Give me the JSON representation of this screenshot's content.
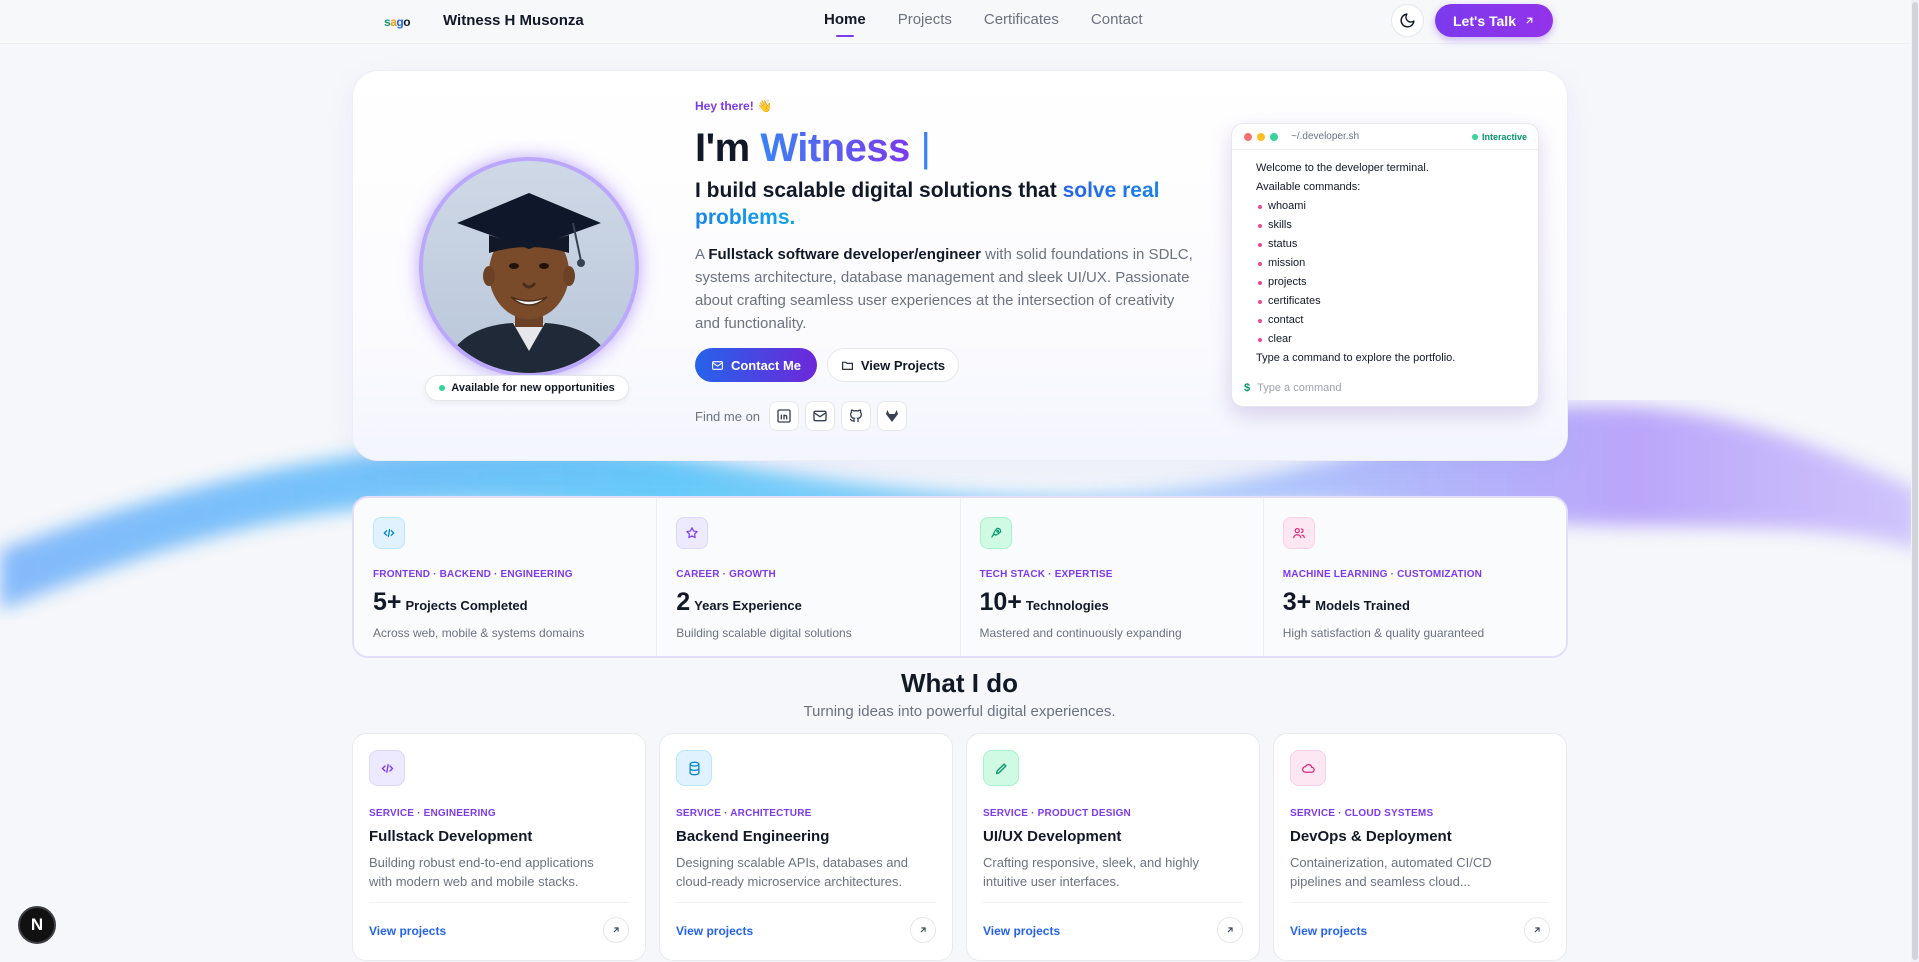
{
  "nav": {
    "logo_parts": [
      "s",
      "a",
      "g",
      "o"
    ],
    "brand": "Witness H Musonza",
    "links": [
      "Home",
      "Projects",
      "Certificates",
      "Contact"
    ],
    "active": "Home",
    "cta": "Let's Talk"
  },
  "hero": {
    "greeting": "Hey there! 👋",
    "im": "I'm",
    "name": "Witness",
    "caret": "|",
    "subhead_plain": "I build scalable digital solutions that",
    "subhead_highlight": "solve real problems.",
    "bio_prefix": "A",
    "bio_bold": "Fullstack software developer/engineer",
    "bio_rest": "with solid foundations in SDLC, systems architecture, database management and sleek UI/UX. Passionate about crafting seamless user experiences at the intersection of creativity and functionality.",
    "contact_btn": "Contact Me",
    "projects_btn": "View Projects",
    "find_label": "Find me on",
    "socials": [
      "linkedin-icon",
      "mail-icon",
      "github-icon",
      "gitlab-icon"
    ],
    "availability": "Available for new opportunities"
  },
  "terminal": {
    "path": "~/.developer.sh",
    "badge": "Interactive",
    "welcome": "Welcome to the developer terminal.",
    "available": "Available commands:",
    "commands": [
      "whoami",
      "skills",
      "status",
      "mission",
      "projects",
      "certificates",
      "contact",
      "clear"
    ],
    "hint": "Type a command to explore the portfolio.",
    "prompt": "$",
    "placeholder": "Type a command"
  },
  "stats": [
    {
      "category": "FRONTEND · BACKEND · ENGINEERING",
      "number": "5+",
      "label": "Projects Completed",
      "desc": "Across web, mobile & systems domains",
      "icon": "code-icon"
    },
    {
      "category": "CAREER · GROWTH",
      "number": "2",
      "label": "Years Experience",
      "desc": "Building scalable digital solutions",
      "icon": "star-icon"
    },
    {
      "category": "TECH STACK · EXPERTISE",
      "number": "10+",
      "label": "Technologies",
      "desc": "Mastered and continuously expanding",
      "icon": "rocket-icon"
    },
    {
      "category": "MACHINE LEARNING · CUSTOMIZATION",
      "number": "3+",
      "label": "Models Trained",
      "desc": "High satisfaction & quality guaranteed",
      "icon": "users-icon"
    }
  ],
  "services_section": {
    "title": "What I do",
    "subtitle": "Turning ideas into powerful digital experiences.",
    "items": [
      {
        "category": "SERVICE · ENGINEERING",
        "title": "Fullstack Development",
        "desc": "Building robust end-to-end applications with modern web and mobile stacks.",
        "link": "View projects",
        "icon": "code-icon"
      },
      {
        "category": "SERVICE · ARCHITECTURE",
        "title": "Backend Engineering",
        "desc": "Designing scalable APIs, databases and cloud-ready microservice architectures.",
        "link": "View projects",
        "icon": "database-icon"
      },
      {
        "category": "SERVICE · PRODUCT DESIGN",
        "title": "UI/UX Development",
        "desc": "Crafting responsive, sleek, and highly intuitive user interfaces.",
        "link": "View projects",
        "icon": "pen-icon"
      },
      {
        "category": "SERVICE · CLOUD SYSTEMS",
        "title": "DevOps & Deployment",
        "desc": "Containerization, automated CI/CD pipelines and seamless cloud...",
        "link": "View projects",
        "icon": "cloud-icon"
      }
    ]
  },
  "dev_badge": "N",
  "colors": {
    "accent": "#7c3aed",
    "blue": "#2563eb",
    "text": "#111827",
    "muted": "#6b7280"
  }
}
